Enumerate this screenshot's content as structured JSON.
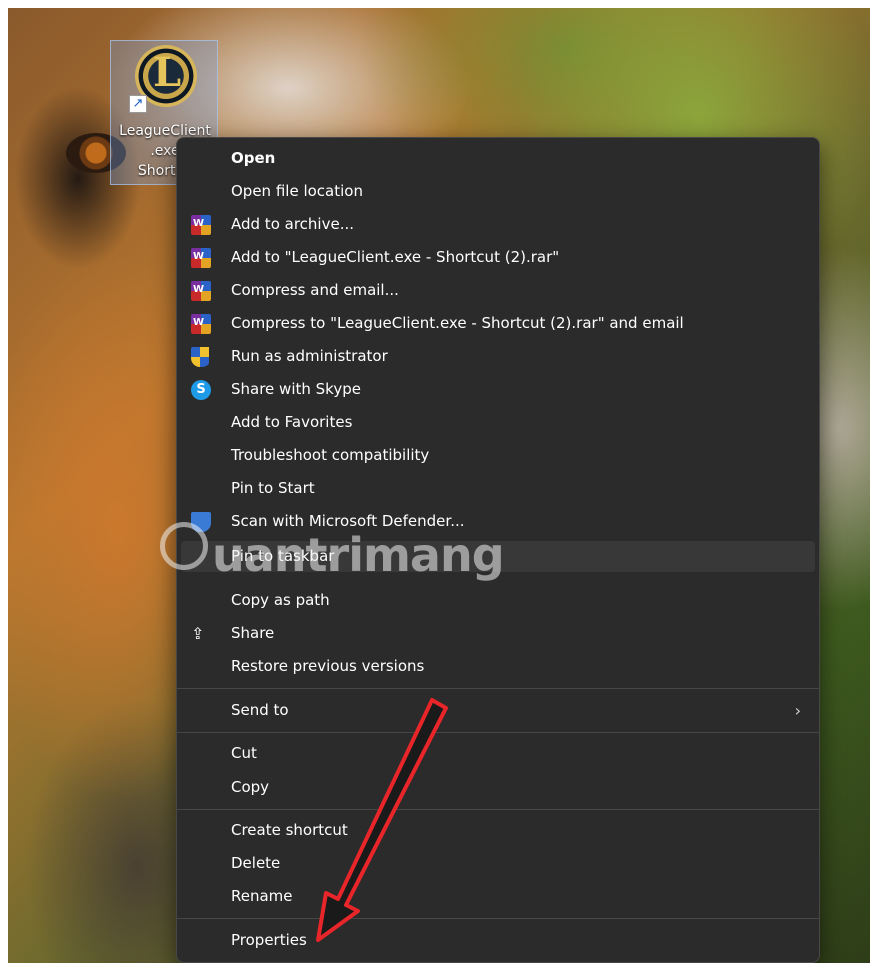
{
  "desktop": {
    "icon_label_line1": "LeagueClient",
    "icon_label_line2": ".exe",
    "icon_label_line3": "Shortcu",
    "logo_letter": "L",
    "shortcut_glyph": "↗"
  },
  "menu": {
    "items": [
      {
        "label": "Open",
        "icon": null,
        "bold": true
      },
      {
        "label": "Open file location",
        "icon": null
      },
      {
        "label": "Add to archive...",
        "icon": "winrar-icon"
      },
      {
        "label": "Add to \"LeagueClient.exe - Shortcut (2).rar\"",
        "icon": "winrar-icon"
      },
      {
        "label": "Compress and email...",
        "icon": "winrar-icon"
      },
      {
        "label": "Compress to \"LeagueClient.exe - Shortcut (2).rar\" and email",
        "icon": "winrar-icon"
      },
      {
        "label": "Run as administrator",
        "icon": "uac-shield-icon"
      },
      {
        "label": "Share with Skype",
        "icon": "skype-icon"
      },
      {
        "label": "Add to Favorites",
        "icon": null
      },
      {
        "label": "Troubleshoot compatibility",
        "icon": null
      },
      {
        "label": "Pin to Start",
        "icon": null
      },
      {
        "label": "Scan with Microsoft Defender...",
        "icon": "defender-icon"
      },
      {
        "label": "Pin to taskbar",
        "icon": null,
        "hover": true
      },
      {
        "label": "Copy as path",
        "icon": null
      },
      {
        "label": "Share",
        "icon": "share-icon"
      },
      {
        "label": "Restore previous versions",
        "icon": null
      },
      {
        "label": "Send to",
        "icon": null,
        "submenu": true
      },
      {
        "label": "Cut",
        "icon": null
      },
      {
        "label": "Copy",
        "icon": null
      },
      {
        "label": "Create shortcut",
        "icon": null
      },
      {
        "label": "Delete",
        "icon": null
      },
      {
        "label": "Rename",
        "icon": null
      },
      {
        "label": "Properties",
        "icon": null
      }
    ],
    "submenu_chevron": "›",
    "skype_glyph": "S",
    "share_glyph": "⇪",
    "rar_glyph": "W"
  },
  "watermark": {
    "text": "uantrimang"
  },
  "annotation": {
    "arrow_color": "#e8262a",
    "points_to": "Properties"
  }
}
